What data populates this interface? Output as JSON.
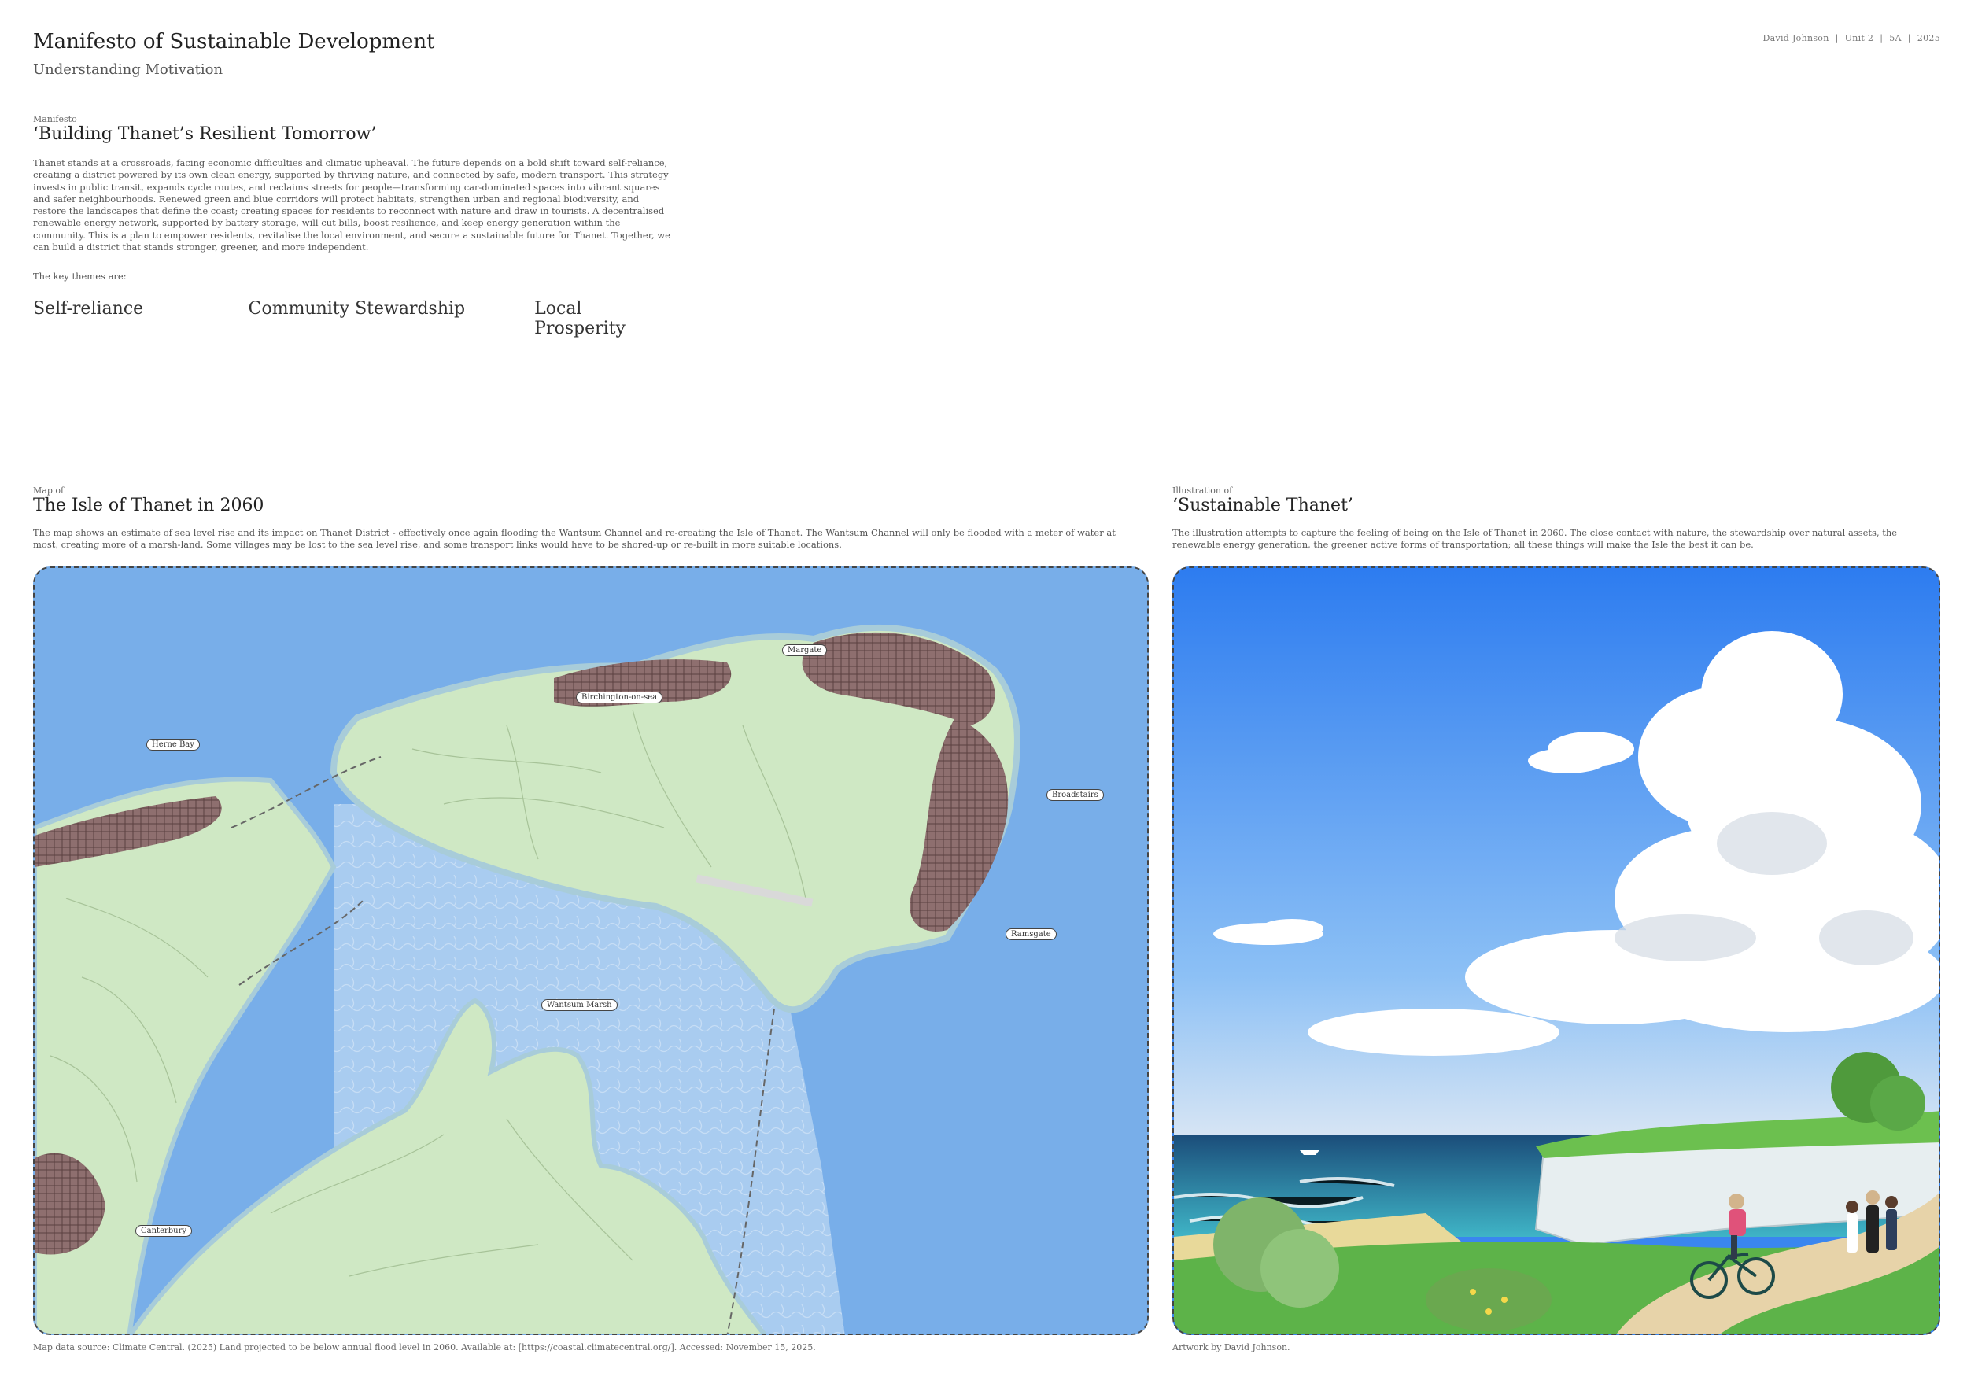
{
  "header": {
    "title": "Manifesto of Sustainable Development",
    "subtitle": "Understanding Motivation",
    "meta": {
      "author": "David Johnson",
      "unit": "Unit 2",
      "group": "5A",
      "year": "2025"
    }
  },
  "manifesto": {
    "eyebrow": "Manifesto",
    "title": "‘Building Thanet’s Resilient Tomorrow’",
    "body": "Thanet stands at a crossroads, facing economic difficulties and climatic upheaval. The future depends on a bold shift toward self-reliance, creating a district powered by its own clean energy, supported by thriving nature, and connected by safe, modern transport. This strategy invests in public transit, expands cycle routes, and reclaims streets for people—transforming car-dominated spaces into vibrant squares and safer neighbourhoods. Renewed green and blue corridors will protect habitats, strengthen urban and regional biodiversity, and restore the landscapes that define the coast; creating spaces for residents to reconnect with nature and draw in tourists. A decentralised renewable energy network, supported by battery storage, will cut bills, boost resilience, and keep energy generation within the community. This is a plan to empower residents, revitalise the local environment, and secure a sustainable future for Thanet. Together, we can build a district that stands stronger, greener, and more independent.",
    "themes_intro": "The key themes are:",
    "themes": [
      "Self-reliance",
      "Community Stewardship",
      "Local Prosperity"
    ]
  },
  "map_section": {
    "eyebrow": "Map of",
    "title": "The Isle of Thanet in 2060",
    "body": "The map shows an estimate of sea level rise and its impact on Thanet District - effectively once again flooding the Wantsum Channel and re-creating the Isle of Thanet. The Wantsum Channel will only be flooded with a meter of water at most, creating more of a marsh-land. Some villages may be lost to the sea level rise, and some transport links would have to be shored-up or re-built in more suitable locations.",
    "labels": {
      "margate": "Margate",
      "birchington": "Birchington-on-sea",
      "herne_bay": "Herne Bay",
      "broadstairs": "Broadstairs",
      "ramsgate": "Ramsgate",
      "wantsum_marsh": "Wantsum Marsh",
      "canterbury": "Canterbury"
    },
    "caption": "Map data source: Climate Central. (2025) Land projected to be below annual flood level in 2060. Available at: [https://coastal.climatecentral.org/]. Accessed: November 15, 2025."
  },
  "illustration_section": {
    "eyebrow": "Illustration of",
    "title": "‘Sustainable Thanet’",
    "body": "The illustration attempts to capture the feeling of being on the Isle of Thanet in 2060. The close contact with nature, the stewardship over natural assets, the renewable energy generation, the greener active forms of transportation; all these things will make the Isle the best it can be.",
    "caption": "Artwork by David Johnson."
  },
  "colors": {
    "sea": "#78aee9",
    "land": "#cfe8c4",
    "urban": "#7a5a5a",
    "marsh": "#a6c9ef",
    "sky": "#3a86ef",
    "grass": "#58b54a",
    "cliff": "#e8eeee"
  }
}
